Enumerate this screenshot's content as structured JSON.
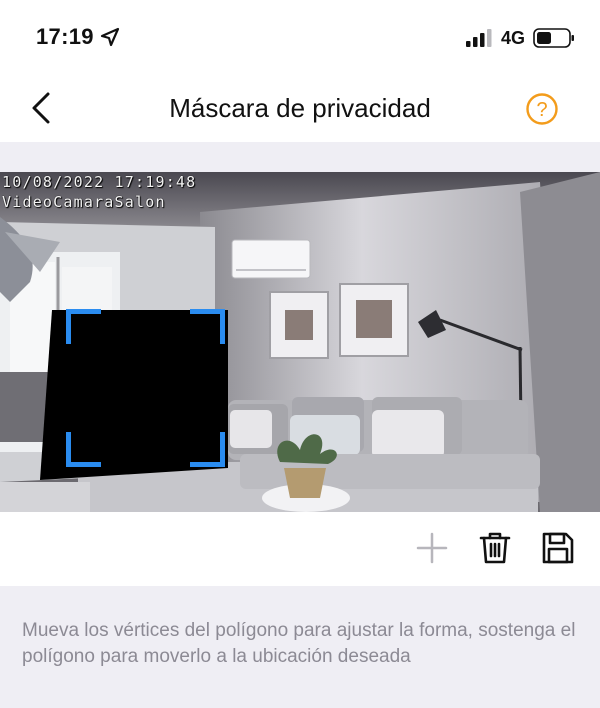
{
  "status_bar": {
    "time": "17:19",
    "location_icon": "location-arrow-icon",
    "signal_icon": "cellular-signal-icon",
    "network": "4G",
    "battery_icon": "battery-icon"
  },
  "nav": {
    "back_icon": "chevron-left-icon",
    "title": "Máscara de privacidad",
    "help_icon": "question-circle-icon",
    "accent_color": "#f39c1b"
  },
  "camera": {
    "osd_datetime": "10/08/2022 17:19:48",
    "osd_camera_name": "VideoCamaraSalon",
    "mask_color": "#000000",
    "handle_color": "#2a8cf0"
  },
  "toolbar": {
    "add_icon": "plus-icon",
    "add_disabled": true,
    "delete_icon": "trash-icon",
    "save_icon": "save-icon"
  },
  "hint": {
    "text": "Mueva los vértices del polígono para ajustar la forma, sostenga el polígono para moverlo a la ubicación deseada"
  }
}
